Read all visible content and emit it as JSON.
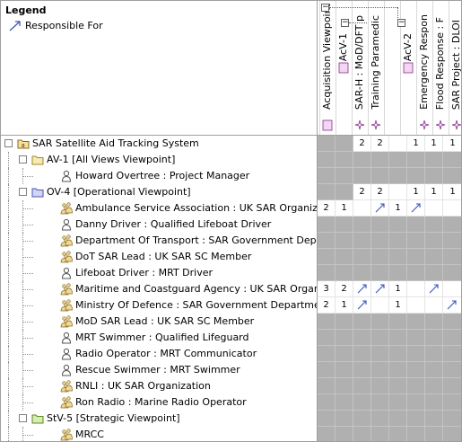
{
  "legend": {
    "title": "Legend",
    "item_label": "Responsible For",
    "arrow_color": "#3a4fb5"
  },
  "columns": [
    {
      "label": "Acquisition Viewpoint [",
      "kind": "package"
    },
    {
      "label": "AcV-1",
      "kind": "diagram"
    },
    {
      "label": "SAR-H : MoD/DFT p",
      "kind": "actor"
    },
    {
      "label": "Training Paramedic",
      "kind": "actor"
    },
    {
      "label": "",
      "kind": "blank"
    },
    {
      "label": "AcV-2",
      "kind": "diagram"
    },
    {
      "label": "Emergency Respon",
      "kind": "actor"
    },
    {
      "label": "Flood Response : F",
      "kind": "actor"
    },
    {
      "label": "SAR Project : DLOI",
      "kind": "actor"
    }
  ],
  "rows": [
    {
      "label": "SAR Satellite Aid Tracking System",
      "icon": "model-icon",
      "expander": "-",
      "cells": [
        "g",
        "g",
        "2",
        "2",
        "",
        "1",
        "1",
        "1"
      ]
    },
    {
      "label": "AV-1 [All Views Viewpoint]",
      "icon": "folder-icon",
      "expander": "-",
      "cells": [
        "g",
        "g",
        "g",
        "g",
        "g",
        "g",
        "g",
        "g"
      ]
    },
    {
      "label": "Howard Overtree : Project Manager",
      "icon": "person-icon",
      "expander": "",
      "cells": [
        "g",
        "g",
        "g",
        "g",
        "g",
        "g",
        "g",
        "g"
      ]
    },
    {
      "label": "OV-4 [Operational Viewpoint]",
      "icon": "ov-folder-icon",
      "expander": "-",
      "cells": [
        "g",
        "g",
        "2",
        "2",
        "",
        "1",
        "1",
        "1"
      ]
    },
    {
      "label": "Ambulance Service Association : UK SAR Organization",
      "icon": "org-icon",
      "expander": "",
      "cells": [
        "2",
        "1",
        "",
        "a",
        "1",
        "a",
        "",
        ""
      ]
    },
    {
      "label": "Danny Driver : Qualified Lifeboat Driver",
      "icon": "person-icon",
      "expander": "",
      "cells": [
        "g",
        "g",
        "g",
        "g",
        "g",
        "g",
        "g",
        "g"
      ]
    },
    {
      "label": "Department Of Transport : SAR Government Department",
      "icon": "org-icon",
      "expander": "",
      "cells": [
        "g",
        "g",
        "g",
        "g",
        "g",
        "g",
        "g",
        "g"
      ]
    },
    {
      "label": "DoT SAR Lead : UK SAR SC Member",
      "icon": "org-icon",
      "expander": "",
      "cells": [
        "g",
        "g",
        "g",
        "g",
        "g",
        "g",
        "g",
        "g"
      ]
    },
    {
      "label": "Lifeboat Driver : MRT Driver",
      "icon": "person-icon",
      "expander": "",
      "cells": [
        "g",
        "g",
        "g",
        "g",
        "g",
        "g",
        "g",
        "g"
      ]
    },
    {
      "label": "Maritime and Coastguard Agency : UK SAR Organization",
      "icon": "org-icon",
      "expander": "",
      "cells": [
        "3",
        "2",
        "a",
        "a",
        "1",
        "",
        "a",
        ""
      ]
    },
    {
      "label": "Ministry Of Defence : SAR Government Department",
      "icon": "org-icon",
      "expander": "",
      "cells": [
        "2",
        "1",
        "a",
        "",
        "1",
        "",
        "",
        "a"
      ]
    },
    {
      "label": "MoD SAR Lead : UK SAR SC Member",
      "icon": "org-icon",
      "expander": "",
      "cells": [
        "g",
        "g",
        "g",
        "g",
        "g",
        "g",
        "g",
        "g"
      ]
    },
    {
      "label": "MRT Swimmer : Qualified Lifeguard",
      "icon": "person-icon",
      "expander": "",
      "cells": [
        "g",
        "g",
        "g",
        "g",
        "g",
        "g",
        "g",
        "g"
      ]
    },
    {
      "label": "Radio Operator : MRT Communicator",
      "icon": "person-icon",
      "expander": "",
      "cells": [
        "g",
        "g",
        "g",
        "g",
        "g",
        "g",
        "g",
        "g"
      ]
    },
    {
      "label": "Rescue Swimmer : MRT Swimmer",
      "icon": "person-icon",
      "expander": "",
      "cells": [
        "g",
        "g",
        "g",
        "g",
        "g",
        "g",
        "g",
        "g"
      ]
    },
    {
      "label": "RNLI : UK SAR Organization",
      "icon": "org-icon",
      "expander": "",
      "cells": [
        "g",
        "g",
        "g",
        "g",
        "g",
        "g",
        "g",
        "g"
      ]
    },
    {
      "label": "Ron Radio : Marine Radio Operator",
      "icon": "org-icon",
      "expander": "",
      "cells": [
        "g",
        "g",
        "g",
        "g",
        "g",
        "g",
        "g",
        "g"
      ]
    },
    {
      "label": "StV-5 [Strategic Viewpoint]",
      "icon": "stv-folder-icon",
      "expander": "-",
      "cells": [
        "g",
        "g",
        "g",
        "g",
        "g",
        "g",
        "g",
        "g"
      ]
    },
    {
      "label": "MRCC",
      "icon": "org-icon",
      "expander": "",
      "cells": [
        "g",
        "g",
        "g",
        "g",
        "g",
        "g",
        "g",
        "g"
      ]
    }
  ]
}
